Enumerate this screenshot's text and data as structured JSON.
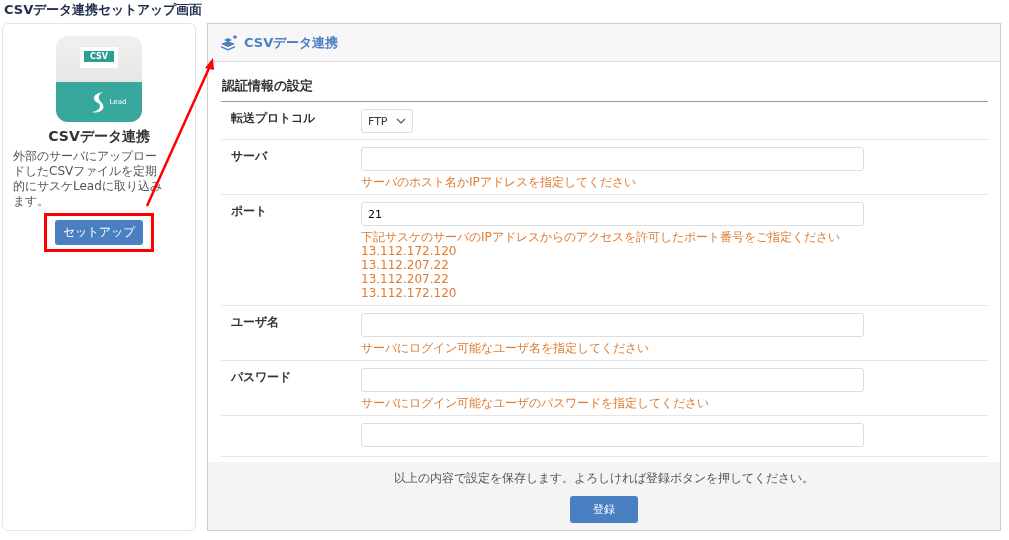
{
  "page_title": "CSVデータ連携セットアップ画面",
  "app_card": {
    "icon_texts": {
      "file_label": "CSV",
      "brand": "Lead"
    },
    "name": "CSVデータ連携",
    "description": "外部のサーバにアップロードしたCSVファイルを定期的にサスケLeadに取り込みます。",
    "button": "セットアップ"
  },
  "panel": {
    "title": "CSVデータ連携",
    "section_title": "認証情報の設定",
    "rows": [
      {
        "label": "転送プロトコル",
        "kind": "select",
        "value": "FTP"
      },
      {
        "label": "サーバ",
        "kind": "text",
        "hints": [
          "サーバのホスト名かIPアドレスを指定してください"
        ]
      },
      {
        "label": "ポート",
        "kind": "text",
        "value": "21",
        "hints": [
          "下記サスケのサーバのIPアドレスからのアクセスを許可したポート番号をご指定ください",
          "13.112.172.120",
          "13.112.207.22",
          "13.112.207.22",
          "13.112.172.120"
        ]
      },
      {
        "label": "ユーザ名",
        "kind": "text",
        "hints": [
          "サーバにログイン可能なユーザ名を指定してください"
        ]
      },
      {
        "label": "パスワード",
        "kind": "text",
        "hints": [
          "サーバにログイン可能なユーザのパスワードを指定してください"
        ]
      },
      {
        "kind": "text"
      }
    ],
    "footer_note": "以上の内容で設定を保存します。よろしければ登録ボタンを押してください。",
    "submit": "登録"
  }
}
